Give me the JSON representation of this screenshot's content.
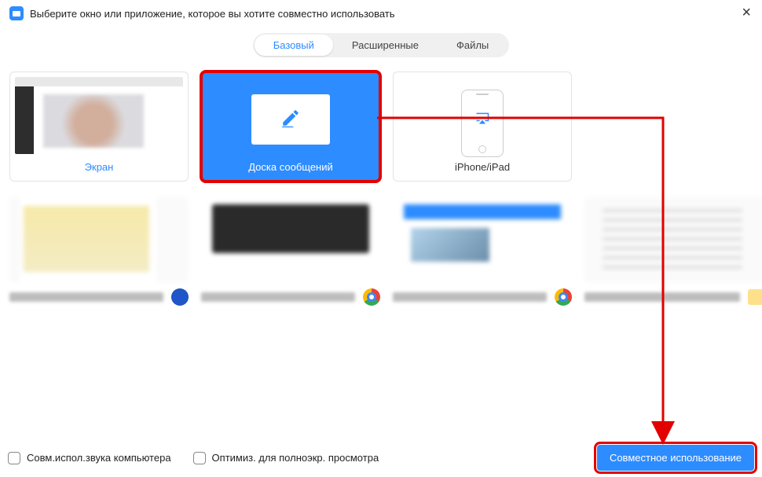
{
  "dialog": {
    "title": "Выберите окно или приложение, которое вы хотите совместно использовать"
  },
  "tabs": {
    "basic": "Базовый",
    "advanced": "Расширенные",
    "files": "Файлы"
  },
  "cards": {
    "screen": "Экран",
    "whiteboard": "Доска сообщений",
    "iphone": "iPhone/iPad"
  },
  "footer": {
    "shareAudio": "Совм.испол.звука компьютера",
    "optimizeVideo": "Оптимиз. для полноэкр. просмотра",
    "shareButton": "Совместное использование"
  },
  "icons": {
    "close": "×"
  }
}
